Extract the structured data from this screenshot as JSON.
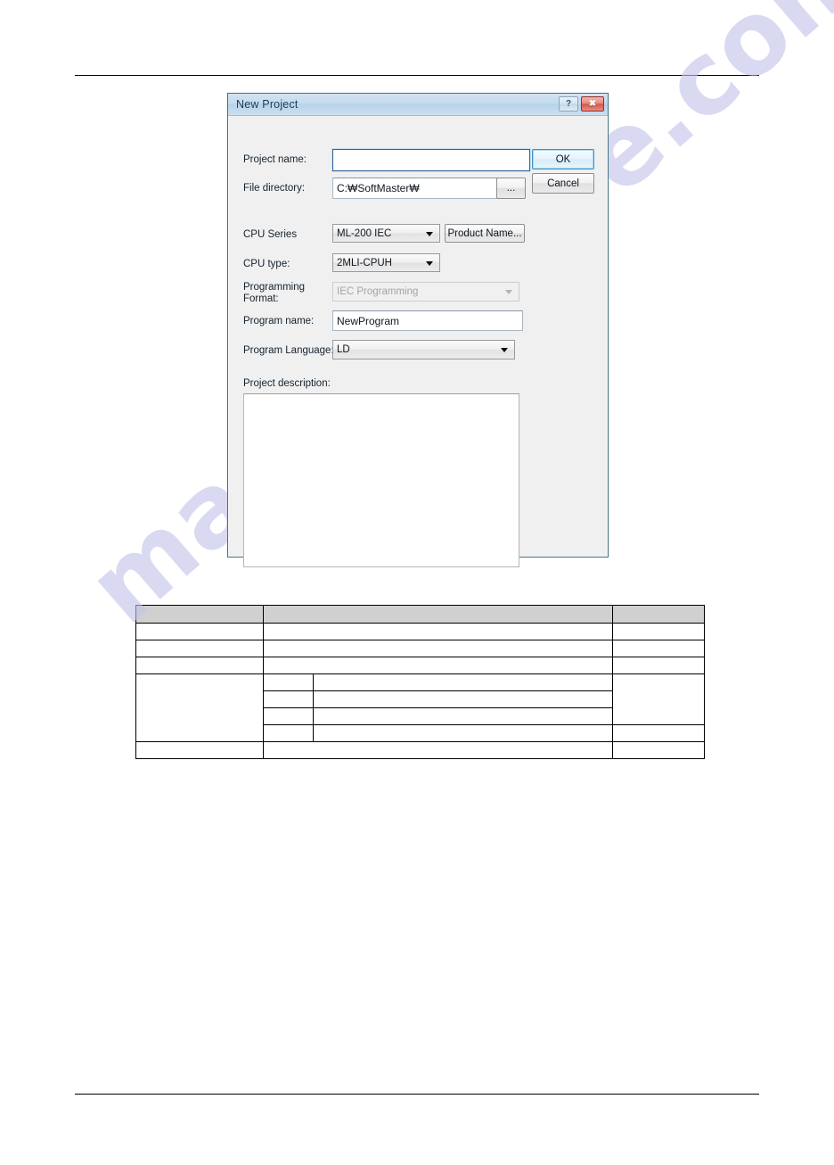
{
  "page": {
    "rules": {
      "top": "horizontal-rule",
      "bottom": "horizontal-rule"
    },
    "watermark_text": "manualshive.com",
    "watermark_color": "#c3c3ea"
  },
  "dialog": {
    "title": "New Project",
    "titlebar_buttons": [
      {
        "name": "help-button",
        "glyph": "?"
      },
      {
        "name": "close-button",
        "glyph": "✖"
      }
    ],
    "fields": {
      "project_name": {
        "label": "Project name:",
        "value": "",
        "placeholder": ""
      },
      "file_directory": {
        "label": "File directory:",
        "value": "C:₩SoftMaster₩",
        "browse_label": "..."
      },
      "cpu_series": {
        "label": "CPU Series",
        "value": "ML-200 IEC"
      },
      "product_name_button": {
        "label": "Product Name..."
      },
      "cpu_type": {
        "label": "CPU type:",
        "value": "2MLI-CPUH"
      },
      "programming_format": {
        "label_line1": "Programming",
        "label_line2": "Format:",
        "value": "IEC Programming",
        "disabled": true
      },
      "program_name": {
        "label": "Program name:",
        "value": "NewProgram"
      },
      "program_language": {
        "label": "Program Language:",
        "value": "LD"
      },
      "project_description": {
        "label": "Project description:",
        "value": ""
      }
    },
    "buttons": {
      "ok": "OK",
      "cancel": "Cancel"
    },
    "accent_color": "#3c93c7",
    "border_color": "#41707e"
  },
  "spec_table": {
    "header": [
      "",
      "",
      "",
      ""
    ],
    "rows": [
      {
        "cells": [
          "",
          "",
          ""
        ]
      },
      {
        "cells": [
          "",
          "",
          ""
        ]
      },
      {
        "cells": [
          "",
          "",
          ""
        ]
      },
      {
        "cells": [
          "",
          "",
          "",
          ""
        ]
      },
      {
        "cells": [
          "",
          "",
          ""
        ]
      },
      {
        "cells": [
          "",
          "",
          ""
        ]
      },
      {
        "cells": [
          "",
          "",
          ""
        ]
      },
      {
        "cells": [
          "",
          "",
          ""
        ]
      }
    ]
  }
}
